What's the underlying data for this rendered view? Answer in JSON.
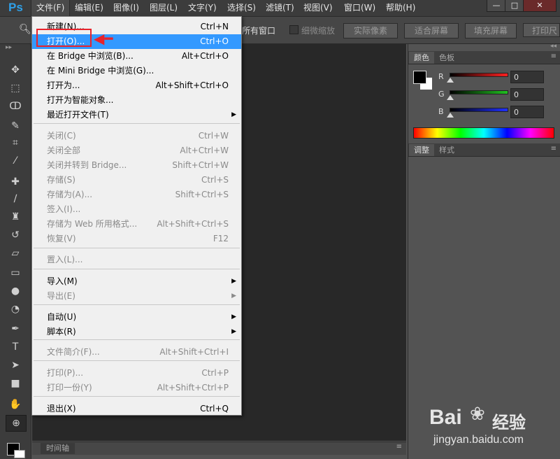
{
  "app": {
    "logo": "Ps"
  },
  "menubar": [
    {
      "label": "文件(F)",
      "active": true
    },
    {
      "label": "编辑(E)"
    },
    {
      "label": "图像(I)"
    },
    {
      "label": "图层(L)"
    },
    {
      "label": "文字(Y)"
    },
    {
      "label": "选择(S)"
    },
    {
      "label": "滤镜(T)"
    },
    {
      "label": "视图(V)"
    },
    {
      "label": "窗口(W)"
    },
    {
      "label": "帮助(H)"
    }
  ],
  "window_controls": [
    "—",
    "□",
    "✕"
  ],
  "options_bar": {
    "all_windows": "所有窗口",
    "scrubby_zoom": "细微缩放",
    "actual_pixels": "实际像素",
    "fit_screen": "适合屏幕",
    "fill_screen": "填充屏幕",
    "print_size": "打印尺"
  },
  "file_menu": [
    {
      "label": "新建(N)...",
      "shortcut": "Ctrl+N"
    },
    {
      "label": "打开(O)...",
      "shortcut": "Ctrl+O",
      "highlighted": true
    },
    {
      "label": "在 Bridge 中浏览(B)...",
      "shortcut": "Alt+Ctrl+O"
    },
    {
      "label": "在 Mini Bridge 中浏览(G)...",
      "shortcut": ""
    },
    {
      "label": "打开为...",
      "shortcut": "Alt+Shift+Ctrl+O"
    },
    {
      "label": "打开为智能对象...",
      "shortcut": ""
    },
    {
      "label": "最近打开文件(T)",
      "shortcut": "",
      "submenu": true
    },
    {
      "label": "关闭(C)",
      "shortcut": "Ctrl+W",
      "disabled": true
    },
    {
      "label": "关闭全部",
      "shortcut": "Alt+Ctrl+W",
      "disabled": true
    },
    {
      "label": "关闭并转到 Bridge...",
      "shortcut": "Shift+Ctrl+W",
      "disabled": true
    },
    {
      "label": "存储(S)",
      "shortcut": "Ctrl+S",
      "disabled": true
    },
    {
      "label": "存储为(A)...",
      "shortcut": "Shift+Ctrl+S",
      "disabled": true
    },
    {
      "label": "签入(I)...",
      "shortcut": "",
      "disabled": true
    },
    {
      "label": "存储为 Web 所用格式...",
      "shortcut": "Alt+Shift+Ctrl+S",
      "disabled": true
    },
    {
      "label": "恢复(V)",
      "shortcut": "F12",
      "disabled": true
    },
    {
      "label": "置入(L)...",
      "shortcut": "",
      "disabled": true
    },
    {
      "label": "导入(M)",
      "shortcut": "",
      "submenu": true
    },
    {
      "label": "导出(E)",
      "shortcut": "",
      "submenu": true,
      "disabled": true
    },
    {
      "label": "自动(U)",
      "shortcut": "",
      "submenu": true
    },
    {
      "label": "脚本(R)",
      "shortcut": "",
      "submenu": true
    },
    {
      "label": "文件简介(F)...",
      "shortcut": "Alt+Shift+Ctrl+I",
      "disabled": true
    },
    {
      "label": "打印(P)...",
      "shortcut": "Ctrl+P",
      "disabled": true
    },
    {
      "label": "打印一份(Y)",
      "shortcut": "Alt+Shift+Ctrl+P",
      "disabled": true
    },
    {
      "label": "退出(X)",
      "shortcut": "Ctrl+Q"
    }
  ],
  "color_panel": {
    "tabs": [
      "颜色",
      "色板"
    ],
    "channels": [
      {
        "name": "R",
        "value": "0",
        "color": "#ff2020"
      },
      {
        "name": "G",
        "value": "0",
        "color": "#20c020"
      },
      {
        "name": "B",
        "value": "0",
        "color": "#2030ff"
      }
    ]
  },
  "adjust_panel": {
    "tabs": [
      "调整",
      "样式"
    ]
  },
  "timeline": {
    "label": "时间轴"
  },
  "watermark": {
    "brand": "Bai",
    "brand2": "经验",
    "url": "jingyan.baidu.com"
  },
  "colors": {
    "highlight": "#3399ff",
    "annotation": "#e8232b"
  }
}
